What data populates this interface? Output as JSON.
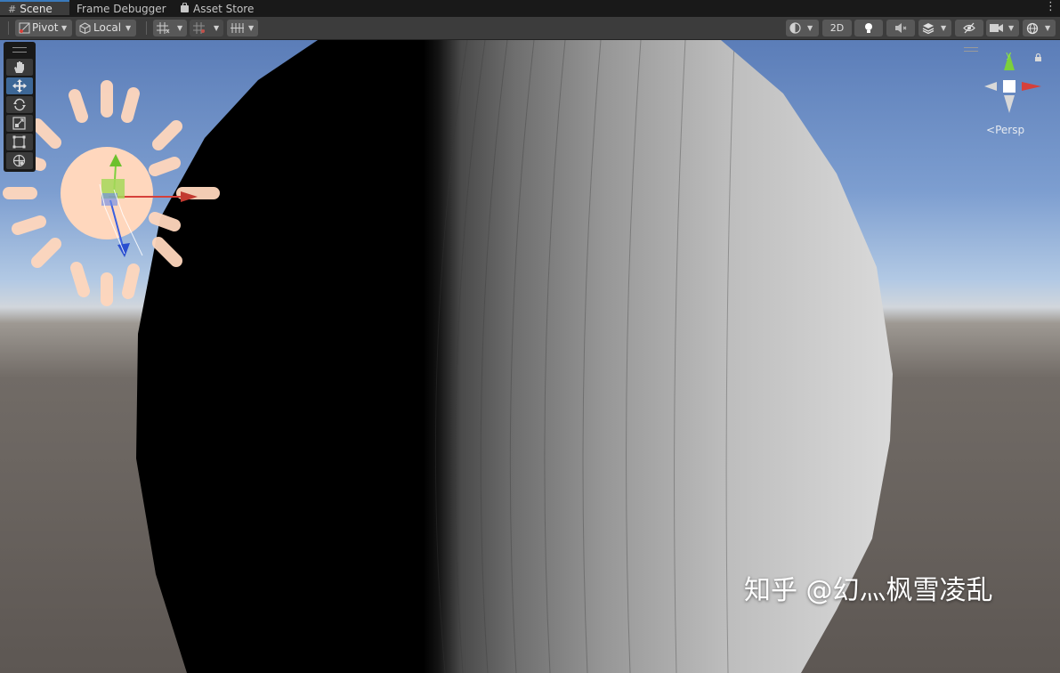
{
  "tabs": [
    {
      "label": "Scene",
      "icon": "grid-icon",
      "active": true
    },
    {
      "label": "Frame Debugger",
      "active": false
    },
    {
      "label": "Asset Store",
      "icon": "bag-icon",
      "active": false
    }
  ],
  "more_icon": "⋮",
  "toolbar": {
    "pivot_label": "Pivot",
    "local_label": "Local",
    "two_d_label": "2D"
  },
  "tools": [
    "hand-tool",
    "move-tool",
    "rotate-tool",
    "scale-tool",
    "rect-tool",
    "transform-tool"
  ],
  "selected_tool": "move-tool",
  "gizmo": {
    "y_label": "y",
    "projection_label": "Persp"
  },
  "watermark": "知乎 @幻灬枫雪凌乱",
  "colors": {
    "accent": "#3a79bb",
    "axis_x": "#d6403a",
    "axis_y": "#7cd03c",
    "axis_z": "#3a5fe0",
    "light_icon": "#ffd7bd"
  }
}
